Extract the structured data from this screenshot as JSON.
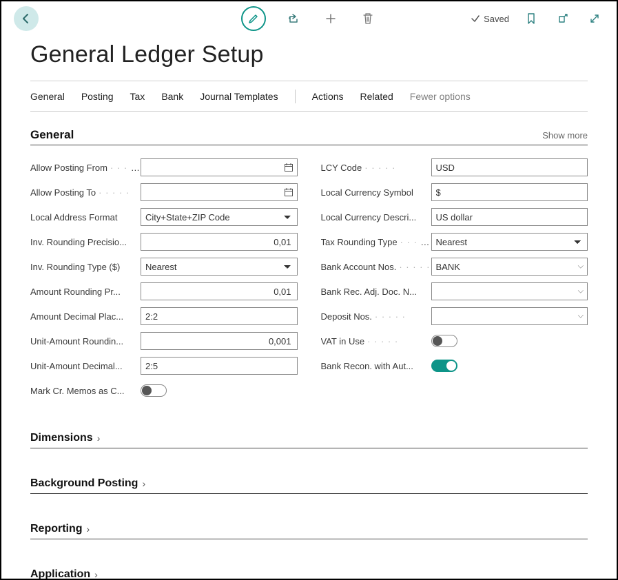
{
  "toolbar": {
    "saved_label": "Saved"
  },
  "page_title": "General Ledger Setup",
  "tabs": [
    "General",
    "Posting",
    "Tax",
    "Bank",
    "Journal Templates"
  ],
  "actions": [
    "Actions",
    "Related"
  ],
  "fewer_label": "Fewer options",
  "general": {
    "title": "General",
    "show_more": "Show more",
    "left": [
      {
        "label": "Allow Posting From",
        "kind": "date",
        "value": ""
      },
      {
        "label": "Allow Posting To",
        "kind": "date",
        "value": ""
      },
      {
        "label": "Local Address Format",
        "kind": "select",
        "value": "City+State+ZIP Code"
      },
      {
        "label": "Inv. Rounding Precisio...",
        "kind": "number",
        "value": "0,01"
      },
      {
        "label": "Inv. Rounding Type ($)",
        "kind": "select",
        "value": "Nearest"
      },
      {
        "label": "Amount Rounding Pr...",
        "kind": "number",
        "value": "0,01"
      },
      {
        "label": "Amount Decimal Plac...",
        "kind": "text",
        "value": "2:2"
      },
      {
        "label": "Unit-Amount Roundin...",
        "kind": "number",
        "value": "0,001"
      },
      {
        "label": "Unit-Amount Decimal...",
        "kind": "text",
        "value": "2:5"
      },
      {
        "label": "Mark Cr. Memos as C...",
        "kind": "toggle",
        "value": false
      }
    ],
    "right": [
      {
        "label": "LCY Code",
        "kind": "text",
        "value": "USD"
      },
      {
        "label": "Local Currency Symbol",
        "kind": "text",
        "value": "$"
      },
      {
        "label": "Local Currency Descri...",
        "kind": "text",
        "value": "US dollar"
      },
      {
        "label": "Tax Rounding Type",
        "kind": "select",
        "value": "Nearest"
      },
      {
        "label": "Bank Account Nos.",
        "kind": "lookup",
        "value": "BANK"
      },
      {
        "label": "Bank Rec. Adj. Doc. N...",
        "kind": "lookup",
        "value": ""
      },
      {
        "label": "Deposit Nos.",
        "kind": "lookup",
        "value": ""
      },
      {
        "label": "VAT in Use",
        "kind": "toggle",
        "value": false
      },
      {
        "label": "Bank Recon. with Aut...",
        "kind": "toggle",
        "value": true
      }
    ]
  },
  "sections": [
    "Dimensions",
    "Background Posting",
    "Reporting",
    "Application"
  ]
}
